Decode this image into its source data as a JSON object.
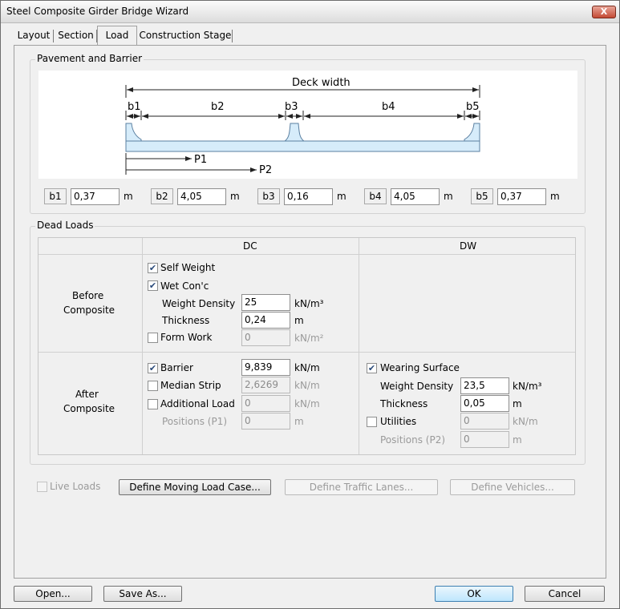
{
  "window": {
    "title": "Steel Composite Girder Bridge Wizard",
    "close_label": "X"
  },
  "tabs": [
    {
      "label": "Layout"
    },
    {
      "label": "Section"
    },
    {
      "label": "Load"
    },
    {
      "label": "Construction Stage"
    }
  ],
  "pavement": {
    "group_title": "Pavement and Barrier",
    "diagram": {
      "deck_width": "Deck width",
      "b1": "b1",
      "b2": "b2",
      "b3": "b3",
      "b4": "b4",
      "b5": "b5",
      "p1": "P1",
      "p2": "P2"
    },
    "fields": [
      {
        "label": "b1",
        "value": "0,37",
        "unit": "m"
      },
      {
        "label": "b2",
        "value": "4,05",
        "unit": "m"
      },
      {
        "label": "b3",
        "value": "0,16",
        "unit": "m"
      },
      {
        "label": "b4",
        "value": "4,05",
        "unit": "m"
      },
      {
        "label": "b5",
        "value": "0,37",
        "unit": "m"
      }
    ]
  },
  "dead_loads": {
    "group_title": "Dead Loads",
    "col_dc": "DC",
    "col_dw": "DW",
    "before": {
      "row_label_1": "Before",
      "row_label_2": "Composite",
      "self_weight": "Self Weight",
      "wet_conc": "Wet Con'c",
      "weight_density_label": "Weight Density",
      "weight_density_value": "25",
      "weight_density_unit": "kN/m³",
      "thickness_label": "Thickness",
      "thickness_value": "0,24",
      "thickness_unit": "m",
      "form_work": "Form Work",
      "form_work_value": "0",
      "form_work_unit": "kN/m²"
    },
    "after": {
      "row_label_1": "After",
      "row_label_2": "Composite",
      "barrier": "Barrier",
      "barrier_value": "9,839",
      "barrier_unit": "kN/m",
      "median_strip": "Median Strip",
      "median_strip_value": "2,6269",
      "median_strip_unit": "kN/m",
      "additional_load": "Additional Load",
      "additional_load_value": "0",
      "additional_load_unit": "kN/m",
      "positions_p1": "Positions (P1)",
      "positions_p1_value": "0",
      "positions_p1_unit": "m",
      "wearing_surface": "Wearing Surface",
      "ws_density_label": "Weight Density",
      "ws_density_value": "23,5",
      "ws_density_unit": "kN/m³",
      "ws_thickness_label": "Thickness",
      "ws_thickness_value": "0,05",
      "ws_thickness_unit": "m",
      "utilities": "Utilities",
      "utilities_value": "0",
      "utilities_unit": "kN/m",
      "positions_p2": "Positions (P2)",
      "positions_p2_value": "0",
      "positions_p2_unit": "m"
    }
  },
  "live_loads": {
    "label": "Live Loads",
    "define_moving_load": "Define Moving Load Case...",
    "define_traffic_lanes": "Define Traffic Lanes...",
    "define_vehicles": "Define Vehicles..."
  },
  "footer": {
    "open": "Open...",
    "save_as": "Save As...",
    "ok": "OK",
    "cancel": "Cancel"
  },
  "icons": {
    "checkbox_checked": "check-icon",
    "close": "close-icon"
  },
  "colors": {
    "deck_fill": "#d6ecfa",
    "deck_stroke": "#5a7fa0"
  }
}
